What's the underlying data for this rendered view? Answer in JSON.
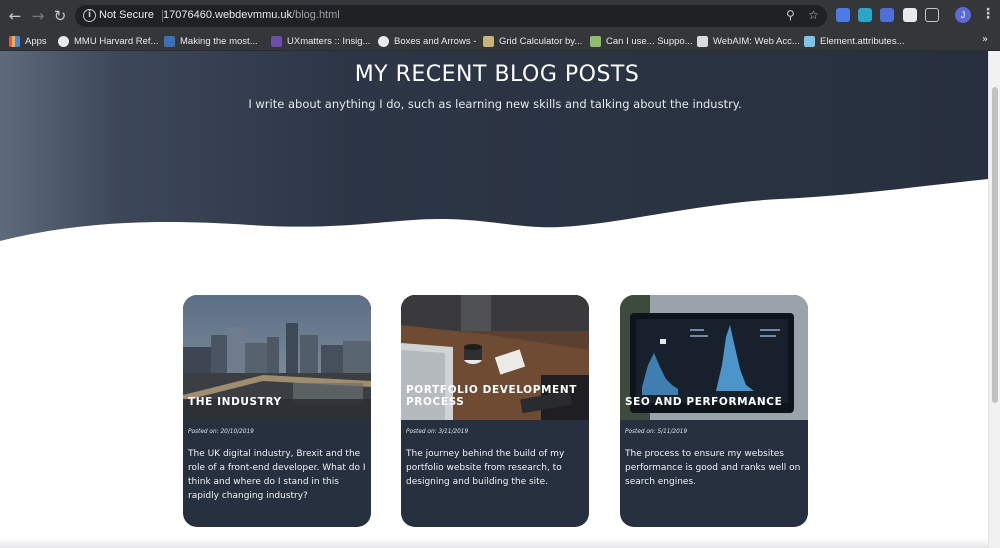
{
  "browser": {
    "security_label": "Not Secure",
    "url_host": "17076460.webdevmmu.uk",
    "url_path": "/blog.html",
    "profile_initial": "J"
  },
  "bookmarks": {
    "items": [
      {
        "label": "Apps",
        "icon": "apps-grid-icon"
      },
      {
        "label": "MMU Harvard Ref...",
        "icon": "globe-icon"
      },
      {
        "label": "Making the most...",
        "icon": "w-icon"
      },
      {
        "label": "UXmatters :: Insig...",
        "icon": "ux-icon"
      },
      {
        "label": "Boxes and Arrows -",
        "icon": "globe-icon"
      },
      {
        "label": "Grid Calculator by...",
        "icon": "grid-calculator-icon"
      },
      {
        "label": "Can I use... Suppo...",
        "icon": "caniuse-icon"
      },
      {
        "label": "WebAIM: Web Acc...",
        "icon": "webaim-icon"
      },
      {
        "label": "Element.attributes...",
        "icon": "mdn-icon"
      }
    ],
    "overflow_label": "»"
  },
  "hero": {
    "title": "MY RECENT BLOG POSTS",
    "subtitle": "I write about anything I do, such as learning new skills and talking about the industry."
  },
  "posts": [
    {
      "title": "THE INDUSTRY",
      "date": "Posted on: 20/10/2019",
      "excerpt": "The UK digital industry, Brexit and the role of a front-end developer. What do I think and where do I stand in this rapidly changing industry?",
      "image": "city-skyline-image"
    },
    {
      "title": "PORTFOLIO DEVELOPMENT PROCESS",
      "date": "Posted on: 3/11/2019",
      "excerpt": "The journey behind the build of my portfolio website from research, to designing and building the site.",
      "image": "laptop-desk-image"
    },
    {
      "title": "SEO AND PERFORMANCE",
      "date": "Posted on: 5/11/2019",
      "excerpt": "The process to ensure my websites performance is good and ranks well on search engines.",
      "image": "analytics-laptop-image"
    }
  ],
  "colors": {
    "hero_dark": "#27303e",
    "card_bg": "#27303e",
    "browser_chrome": "#35363a"
  }
}
